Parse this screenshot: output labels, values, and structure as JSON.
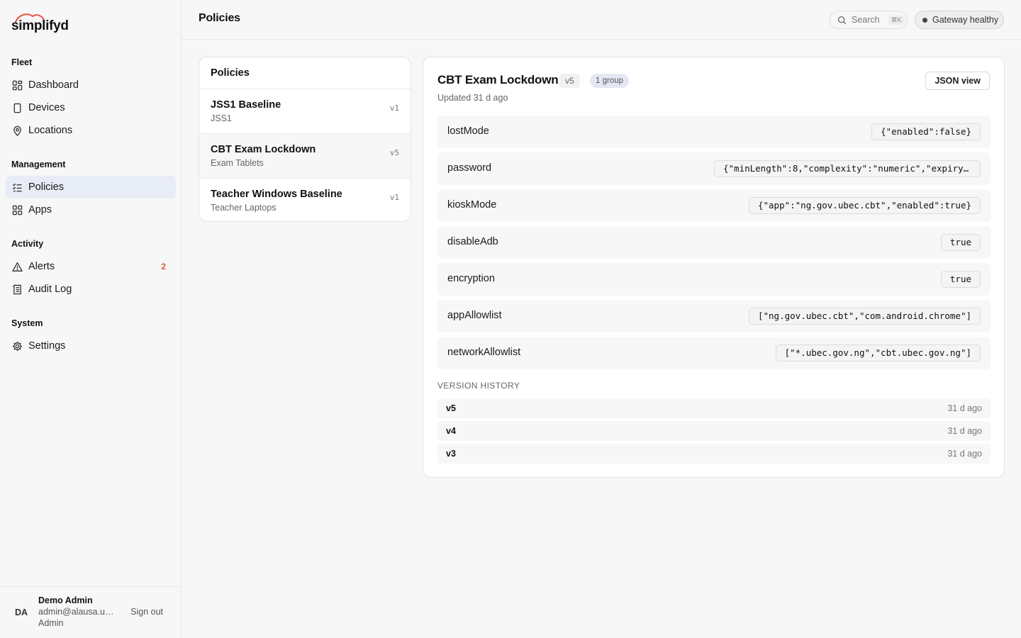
{
  "brand": {
    "name": "simplifyd",
    "accent": "#e5533d"
  },
  "sidebar": {
    "sections": [
      {
        "heading": "Fleet",
        "items": [
          {
            "label": "Dashboard",
            "icon": "dashboard-icon"
          },
          {
            "label": "Devices",
            "icon": "device-icon"
          },
          {
            "label": "Locations",
            "icon": "location-pin-icon"
          }
        ]
      },
      {
        "heading": "Management",
        "items": [
          {
            "label": "Policies",
            "icon": "policies-icon",
            "active": true
          },
          {
            "label": "Apps",
            "icon": "apps-grid-icon"
          }
        ]
      },
      {
        "heading": "Activity",
        "items": [
          {
            "label": "Alerts",
            "icon": "alert-triangle-icon",
            "badge": "2"
          },
          {
            "label": "Audit Log",
            "icon": "audit-log-icon"
          }
        ]
      },
      {
        "heading": "System",
        "items": [
          {
            "label": "Settings",
            "icon": "gear-icon"
          }
        ]
      }
    ],
    "user": {
      "initials": "DA",
      "name": "Demo Admin",
      "email": "admin@alausa.ub...",
      "role": "Admin",
      "signout_label": "Sign out"
    }
  },
  "topbar": {
    "title": "Policies",
    "search_label": "Search",
    "search_shortcut": "⌘K",
    "gateway_status": "Gateway healthy"
  },
  "policies_list": {
    "header": "Policies",
    "items": [
      {
        "name": "JSS1 Baseline",
        "group": "JSS1",
        "version": "v1"
      },
      {
        "name": "CBT Exam Lockdown",
        "group": "Exam Tablets",
        "version": "v5",
        "selected": true
      },
      {
        "name": "Teacher Windows Baseline",
        "group": "Teacher Laptops",
        "version": "v1"
      }
    ]
  },
  "detail": {
    "title": "CBT Exam Lockdown",
    "version": "v5",
    "groups": "1 group",
    "updated": "Updated 31 d ago",
    "json_view_label": "JSON view",
    "settings": [
      {
        "key": "lostMode",
        "value": "{\"enabled\":false}"
      },
      {
        "key": "password",
        "value": "{\"minLength\":8,\"complexity\":\"numeric\",\"expiryDa…"
      },
      {
        "key": "kioskMode",
        "value": "{\"app\":\"ng.gov.ubec.cbt\",\"enabled\":true}"
      },
      {
        "key": "disableAdb",
        "value": "true"
      },
      {
        "key": "encryption",
        "value": "true"
      },
      {
        "key": "appAllowlist",
        "value": "[\"ng.gov.ubec.cbt\",\"com.android.chrome\"]"
      },
      {
        "key": "networkAllowlist",
        "value": "[\"*.ubec.gov.ng\",\"cbt.ubec.gov.ng\"]"
      }
    ],
    "version_history_heading": "VERSION HISTORY",
    "version_history": [
      {
        "version": "v5",
        "time": "31 d ago"
      },
      {
        "version": "v4",
        "time": "31 d ago"
      },
      {
        "version": "v3",
        "time": "31 d ago"
      }
    ]
  }
}
